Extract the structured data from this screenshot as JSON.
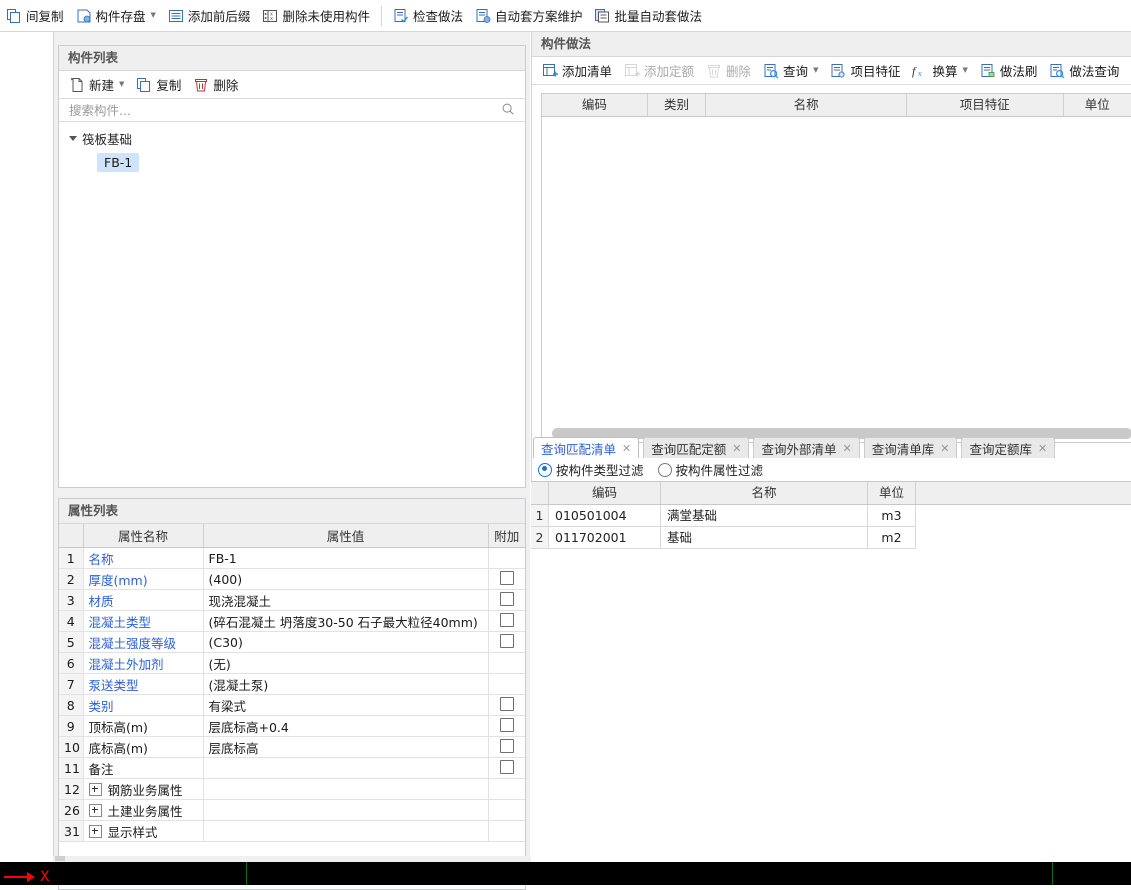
{
  "toolbar": {
    "items": [
      {
        "label": "间复制",
        "icon": "copy-icon",
        "caret": false,
        "truncated": true
      },
      {
        "label": "构件存盘",
        "icon": "save-component-icon",
        "caret": true
      },
      {
        "label": "添加前后缀",
        "icon": "add-affix-icon",
        "caret": false
      },
      {
        "label": "删除未使用构件",
        "icon": "delete-unused-icon",
        "caret": false
      },
      {
        "label": "检查做法",
        "icon": "check-method-icon",
        "caret": false
      },
      {
        "label": "自动套方案维护",
        "icon": "auto-scheme-icon",
        "caret": false
      },
      {
        "label": "批量自动套做法",
        "icon": "batch-auto-icon",
        "caret": false
      }
    ]
  },
  "component_list": {
    "title": "构件列表",
    "actions": [
      {
        "label": "新建",
        "icon": "new-file-icon",
        "caret": true
      },
      {
        "label": "复制",
        "icon": "copy-icon",
        "caret": false
      },
      {
        "label": "删除",
        "icon": "trash-icon",
        "caret": false
      }
    ],
    "search": {
      "value": "",
      "placeholder": "搜索构件...",
      "icon": "search-icon"
    },
    "tree": {
      "group": "筏板基础",
      "items": [
        {
          "label": "FB-1",
          "selected": true
        }
      ]
    }
  },
  "attribute_list": {
    "title": "属性列表",
    "columns": [
      "",
      "属性名称",
      "属性值",
      "附加"
    ],
    "rows": [
      {
        "idx": "1",
        "name": "名称",
        "link": true,
        "value": "FB-1",
        "checkbox": false,
        "expander": false
      },
      {
        "idx": "2",
        "name": "厚度(mm)",
        "link": true,
        "value": "(400)",
        "checkbox": true,
        "expander": false
      },
      {
        "idx": "3",
        "name": "材质",
        "link": true,
        "value": "现浇混凝土",
        "checkbox": true,
        "expander": false
      },
      {
        "idx": "4",
        "name": "混凝土类型",
        "link": true,
        "value": "(碎石混凝土 坍落度30-50 石子最大粒径40mm)",
        "checkbox": true,
        "expander": false
      },
      {
        "idx": "5",
        "name": "混凝土强度等级",
        "link": true,
        "value": "(C30)",
        "checkbox": true,
        "expander": false
      },
      {
        "idx": "6",
        "name": "混凝土外加剂",
        "link": true,
        "value": "(无)",
        "checkbox": false,
        "expander": false
      },
      {
        "idx": "7",
        "name": "泵送类型",
        "link": true,
        "value": "(混凝土泵)",
        "checkbox": false,
        "expander": false
      },
      {
        "idx": "8",
        "name": "类别",
        "link": true,
        "value": "有梁式",
        "checkbox": true,
        "expander": false
      },
      {
        "idx": "9",
        "name": "顶标高(m)",
        "link": false,
        "value": "层底标高+0.4",
        "checkbox": true,
        "expander": false
      },
      {
        "idx": "10",
        "name": "底标高(m)",
        "link": false,
        "value": "层底标高",
        "checkbox": true,
        "expander": false
      },
      {
        "idx": "11",
        "name": "备注",
        "link": false,
        "value": "",
        "checkbox": true,
        "expander": false
      },
      {
        "idx": "12",
        "name": "钢筋业务属性",
        "link": false,
        "value": "",
        "checkbox": false,
        "expander": true
      },
      {
        "idx": "26",
        "name": "土建业务属性",
        "link": false,
        "value": "",
        "checkbox": false,
        "expander": true
      },
      {
        "idx": "31",
        "name": "显示样式",
        "link": false,
        "value": "",
        "checkbox": false,
        "expander": true
      }
    ]
  },
  "component_method": {
    "title": "构件做法",
    "actions": [
      {
        "label": "添加清单",
        "icon": "add-list-icon",
        "caret": false,
        "disabled": false
      },
      {
        "label": "添加定额",
        "icon": "add-quota-icon",
        "caret": false,
        "disabled": true
      },
      {
        "label": "删除",
        "icon": "trash-icon",
        "caret": false,
        "disabled": true
      },
      {
        "label": "查询",
        "icon": "query-icon",
        "caret": true,
        "disabled": false
      },
      {
        "label": "项目特征",
        "icon": "project-feature-icon",
        "caret": false,
        "disabled": false
      },
      {
        "label": "换算",
        "icon": "fx-icon",
        "caret": true,
        "disabled": false
      },
      {
        "label": "做法刷",
        "icon": "method-brush-icon",
        "caret": false,
        "disabled": false
      },
      {
        "label": "做法查询",
        "icon": "method-query-icon",
        "caret": false,
        "disabled": false
      },
      {
        "label": "",
        "icon": "method-more-icon",
        "caret": false,
        "disabled": false
      }
    ],
    "columns": [
      "编码",
      "类别",
      "名称",
      "项目特征",
      "单位"
    ],
    "rows": []
  },
  "query_tabs": [
    {
      "label": "查询匹配清单",
      "active": true,
      "closable": true
    },
    {
      "label": "查询匹配定额",
      "active": false,
      "closable": true
    },
    {
      "label": "查询外部清单",
      "active": false,
      "closable": true
    },
    {
      "label": "查询清单库",
      "active": false,
      "closable": true
    },
    {
      "label": "查询定额库",
      "active": false,
      "closable": true
    }
  ],
  "filter": {
    "options": [
      {
        "label": "按构件类型过滤",
        "selected": true
      },
      {
        "label": "按构件属性过滤",
        "selected": false
      }
    ]
  },
  "query_result": {
    "columns": [
      "",
      "编码",
      "名称",
      "单位"
    ],
    "rows": [
      {
        "idx": "1",
        "code": "010501004",
        "name": "满堂基础",
        "unit": "m3"
      },
      {
        "idx": "2",
        "code": "011702001",
        "name": "基础",
        "unit": "m2"
      }
    ]
  },
  "canvas": {
    "axis_label": "X",
    "axis_color": "#ff0000",
    "grid_color": "#0a6b1e",
    "background": "#000000"
  },
  "colors": {
    "accent": "#2b5fd9",
    "selection": "#cfe4fb",
    "panel_header": "#efefef",
    "border": "#c9cdd2"
  }
}
